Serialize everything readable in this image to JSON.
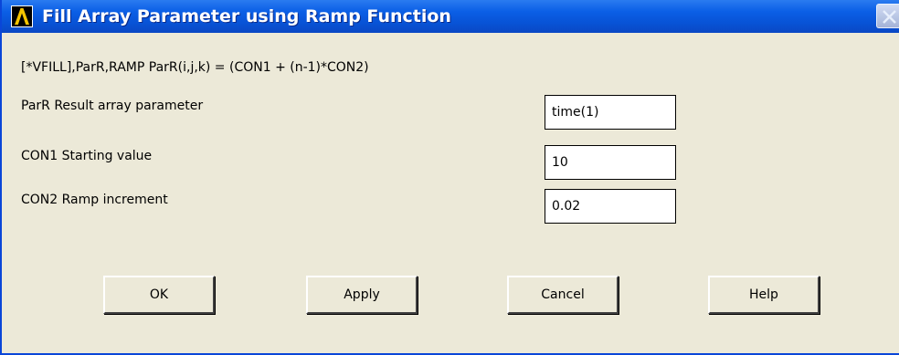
{
  "window": {
    "title": "Fill Array Parameter using Ramp Function",
    "accent_color": "#0a5ae0",
    "icon": "ansys-logo-icon",
    "close_icon": "close-icon"
  },
  "command_line": "[*VFILL],ParR,RAMP    ParR(i,j,k) = (CON1 + (n-1)*CON2)",
  "params": [
    {
      "label": "ParR  Result array parameter",
      "value": "time(1)"
    },
    {
      "label": "CON1  Starting value",
      "value": "10"
    },
    {
      "label": "CON2  Ramp increment",
      "value": "0.02"
    }
  ],
  "buttons": {
    "ok": "OK",
    "apply": "Apply",
    "cancel": "Cancel",
    "help": "Help"
  }
}
